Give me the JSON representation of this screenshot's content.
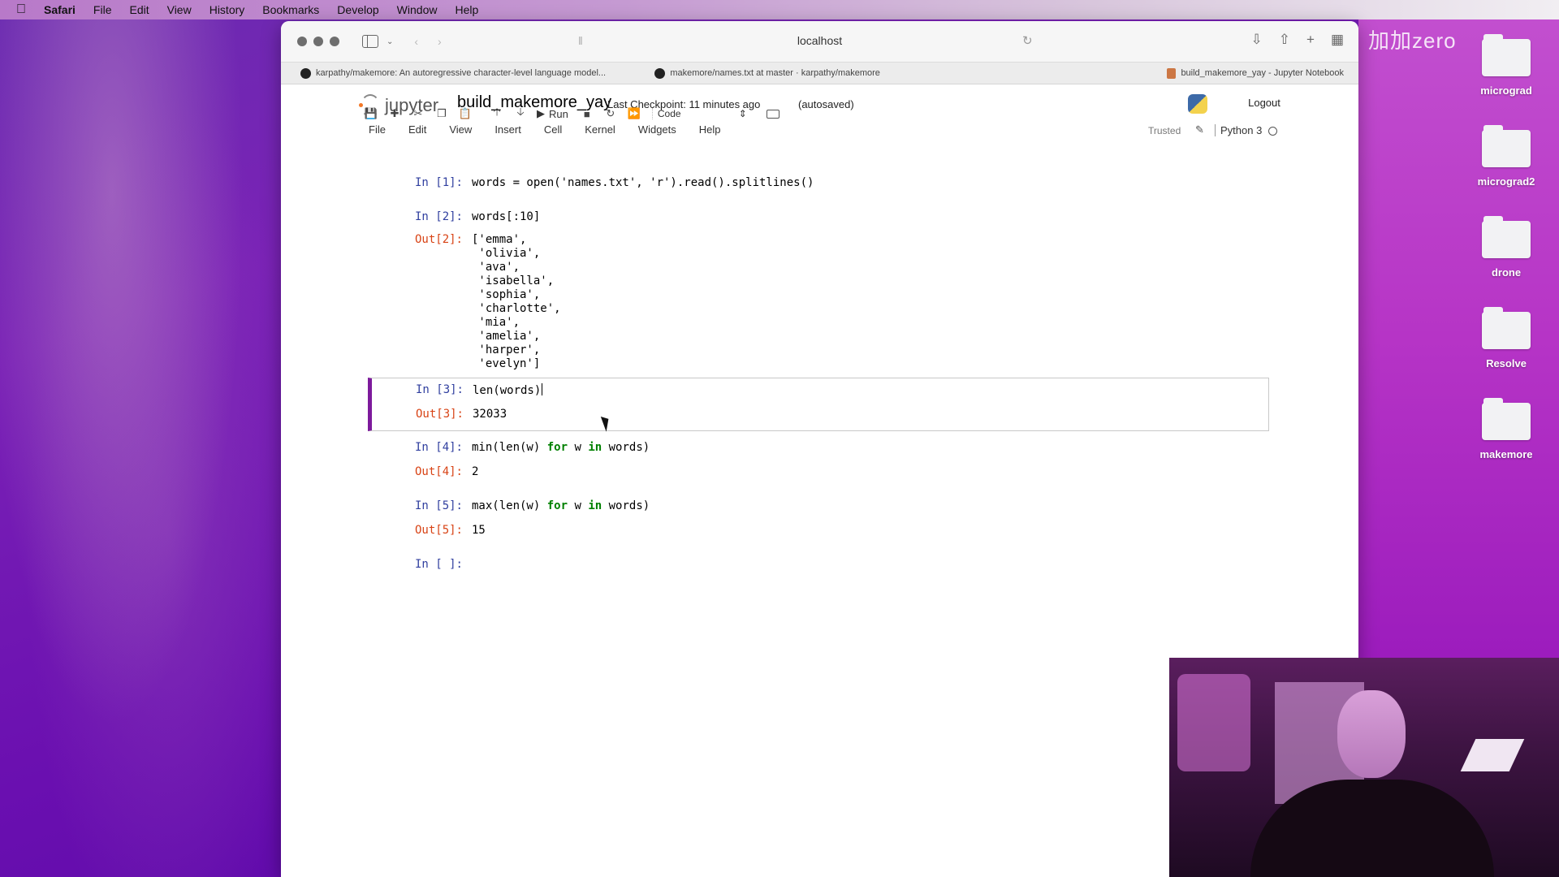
{
  "menubar": {
    "app": "Safari",
    "items": [
      "File",
      "Edit",
      "View",
      "History",
      "Bookmarks",
      "Develop",
      "Window",
      "Help"
    ]
  },
  "desktop": {
    "watermark": "加加zero",
    "icons": [
      {
        "label": "micrograd"
      },
      {
        "label": "micrograd2"
      },
      {
        "label": "drone"
      },
      {
        "label": "Resolve"
      },
      {
        "label": "makemore"
      }
    ]
  },
  "browser": {
    "address": "localhost",
    "tabs": [
      {
        "label": "karpathy/makemore: An autoregressive character-level language model..."
      },
      {
        "label": "makemore/names.txt at master · karpathy/makemore"
      },
      {
        "label": "build_makemore_yay - Jupyter Notebook"
      }
    ]
  },
  "jupyter": {
    "logo_text": "jupyter",
    "notebook_name": "build_makemore_yay",
    "checkpoint": "Last Checkpoint: 11 minutes ago",
    "autosaved": "(autosaved)",
    "logout": "Logout",
    "menu": [
      "File",
      "Edit",
      "View",
      "Insert",
      "Cell",
      "Kernel",
      "Widgets",
      "Help"
    ],
    "trusted": "Trusted",
    "kernel_name": "Python 3",
    "toolbar": {
      "run_label": "Run",
      "cell_type": "Code"
    }
  },
  "cells": [
    {
      "in_prompt": "In [1]:",
      "code": "words = open('names.txt', 'r').read().splitlines()",
      "out_prompt": "",
      "output": ""
    },
    {
      "in_prompt": "In [2]:",
      "code": "words[:10]",
      "out_prompt": "Out[2]:",
      "output": "['emma',\n 'olivia',\n 'ava',\n 'isabella',\n 'sophia',\n 'charlotte',\n 'mia',\n 'amelia',\n 'harper',\n 'evelyn']"
    },
    {
      "in_prompt": "In [3]:",
      "code": "len(words)",
      "out_prompt": "Out[3]:",
      "output": "32033"
    },
    {
      "in_prompt": "In [4]:",
      "code_pre": "min(len(w) ",
      "kw1": "for",
      "code_mid": " w ",
      "kw2": "in",
      "code_post": " words)",
      "out_prompt": "Out[4]:",
      "output": "2"
    },
    {
      "in_prompt": "In [5]:",
      "code_pre": "max(len(w) ",
      "kw1": "for",
      "code_mid": " w ",
      "kw2": "in",
      "code_post": " words)",
      "out_prompt": "Out[5]:",
      "output": "15"
    },
    {
      "in_prompt": "In [ ]:",
      "code": "",
      "out_prompt": "",
      "output": ""
    }
  ],
  "colors": {
    "selected_cell_border": "#7d1a9c",
    "in_prompt": "#303f9f",
    "out_prompt": "#d84315"
  }
}
